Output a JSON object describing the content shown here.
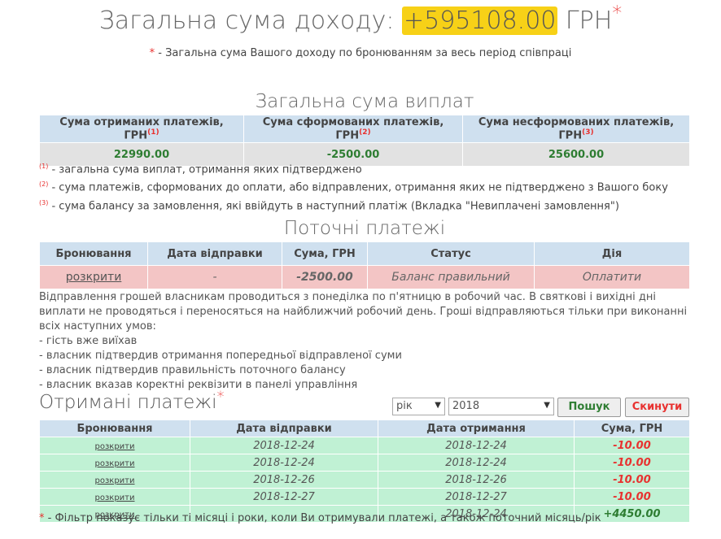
{
  "hero": {
    "prefix": "Загальна сума доходу:",
    "amount": "+595108.00",
    "currency": "ГРН",
    "star": "*",
    "note_star": "*",
    "note": " - Загальна сума Вашого доходу по бронюванням за весь період співпраці"
  },
  "payouts": {
    "title": "Загальна сума виплат",
    "headers": [
      {
        "label": "Сума отриманих платежів, ГРН",
        "mark": "(1)"
      },
      {
        "label": "Сума сформованих платежів, ГРН",
        "mark": "(2)"
      },
      {
        "label": "Сума несформованих платежів, ГРН",
        "mark": "(3)"
      }
    ],
    "values": [
      "22990.00",
      "-2500.00",
      "25600.00"
    ],
    "footnotes": [
      {
        "mark": "(1)",
        "text": " - загальна сума виплат, отримання яких підтверджено"
      },
      {
        "mark": "(2)",
        "text": " - сума платежів, сформованих до оплати, або відправлених, отримання яких не підтверджено з Вашого боку"
      },
      {
        "mark": "(3)",
        "text": " - сума балансу за замовлення, які ввійдуть в наступний платіж (Вкладка \"Невиплачені замовлення\")"
      }
    ]
  },
  "current": {
    "title": "Поточні платежі",
    "headers": [
      "Бронювання",
      "Дата відправки",
      "Сума, ГРН",
      "Статус",
      "Дія"
    ],
    "row": {
      "booking": "розкрити",
      "date": "-",
      "amount": "-2500.00",
      "status": "Баланс правильний",
      "action": "Оплатити"
    }
  },
  "info": {
    "paragraph": "Відправлення грошей власникам проводиться з понеділка по п'ятницю в робочий час. В святкові і вихідні дні виплати не проводяться і переносяться на найближчий робочий день. Гроші відправляються тільки при виконанні всіх наступних умов:",
    "conditions": [
      "- гість вже виїхав",
      "- власник підтвердив отримання попередньої відправленої суми",
      "- власник підтвердив правильність поточного балансу",
      "- власник вказав коректні реквізити в панелі управління"
    ]
  },
  "received": {
    "title": "Отримані платежі",
    "star": "*",
    "filter": {
      "period": "рік",
      "year": "2018",
      "search_label": "Пошук",
      "reset_label": "Скинути"
    },
    "headers": [
      "Бронювання",
      "Дата відправки",
      "Дата отримання",
      "Сума, ГРН"
    ],
    "rows": [
      {
        "booking": "розкрити",
        "sent": "2018-12-24",
        "received": "2018-12-24",
        "amount": "-10.00",
        "sign": "neg"
      },
      {
        "booking": "розкрити",
        "sent": "2018-12-24",
        "received": "2018-12-24",
        "amount": "-10.00",
        "sign": "neg"
      },
      {
        "booking": "розкрити",
        "sent": "2018-12-26",
        "received": "2018-12-26",
        "amount": "-10.00",
        "sign": "neg"
      },
      {
        "booking": "розкрити",
        "sent": "2018-12-27",
        "received": "2018-12-27",
        "amount": "-10.00",
        "sign": "neg"
      },
      {
        "booking": "розкрити",
        "sent": "",
        "received": "2018-12-24",
        "amount": "+4450.00",
        "sign": "pos"
      }
    ],
    "note_star": "*",
    "note": " - Фільтр показує тільки ті місяці і роки, коли Ви отримували платежі, а також поточний місяць/рік"
  },
  "colors": {
    "accent_yellow": "#f7d117",
    "negative": "#e8312f",
    "positive": "#2e7d32",
    "header_blue": "#cfe0ef",
    "row_green": "#c0f1d4",
    "row_red": "#f3c5c5"
  }
}
